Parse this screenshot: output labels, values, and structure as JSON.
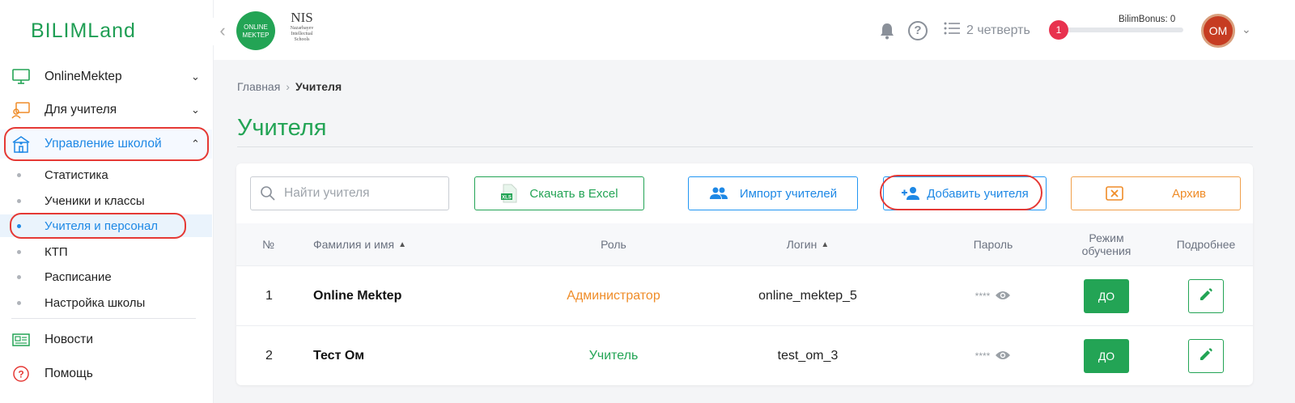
{
  "brand": {
    "logo_text": "BILIMLand",
    "partner1": "ONLINE MEKTEP",
    "partner2": "NIS",
    "partner2_sub": "Nazarbayev Intellectual Schools"
  },
  "header": {
    "quarter": "2 четверть",
    "bonus_label": "BilimBonus: 0",
    "bonus_badge": "1",
    "bonus_progress": 0,
    "avatar_initials": "ОМ"
  },
  "sidebar": {
    "items": [
      {
        "label": "OnlineMektep"
      },
      {
        "label": "Для учителя"
      },
      {
        "label": "Управление школой"
      }
    ],
    "sub_items": [
      {
        "label": "Статистика"
      },
      {
        "label": "Ученики и классы"
      },
      {
        "label": "Учителя и персонал"
      },
      {
        "label": "КТП"
      },
      {
        "label": "Расписание"
      },
      {
        "label": "Настройка школы"
      }
    ],
    "bottom": [
      {
        "label": "Новости"
      },
      {
        "label": "Помощь"
      }
    ]
  },
  "breadcrumb": {
    "home": "Главная",
    "current": "Учителя"
  },
  "page_title": "Учителя",
  "toolbar": {
    "search_placeholder": "Найти учителя",
    "excel": "Скачать в Excel",
    "import": "Импорт учителей",
    "add": "Добавить учителя",
    "archive": "Архив"
  },
  "table": {
    "headers": {
      "num": "№",
      "name": "Фамилия и имя",
      "role": "Роль",
      "login": "Логин",
      "password": "Пароль",
      "mode": "Режим обучения",
      "details": "Подробнее"
    },
    "rows": [
      {
        "num": "1",
        "name": "Online Mektep",
        "role": "Администратор",
        "login": "online_mektep_5",
        "password": "****",
        "mode": "ДО"
      },
      {
        "num": "2",
        "name": "Тест Ом",
        "role": "Учитель",
        "login": "test_om_3",
        "password": "****",
        "mode": "ДО"
      }
    ]
  },
  "colors": {
    "brand_green": "#23a455",
    "accent_blue": "#1e88e5",
    "accent_orange": "#ef8c28",
    "highlight_red": "#e53935"
  }
}
